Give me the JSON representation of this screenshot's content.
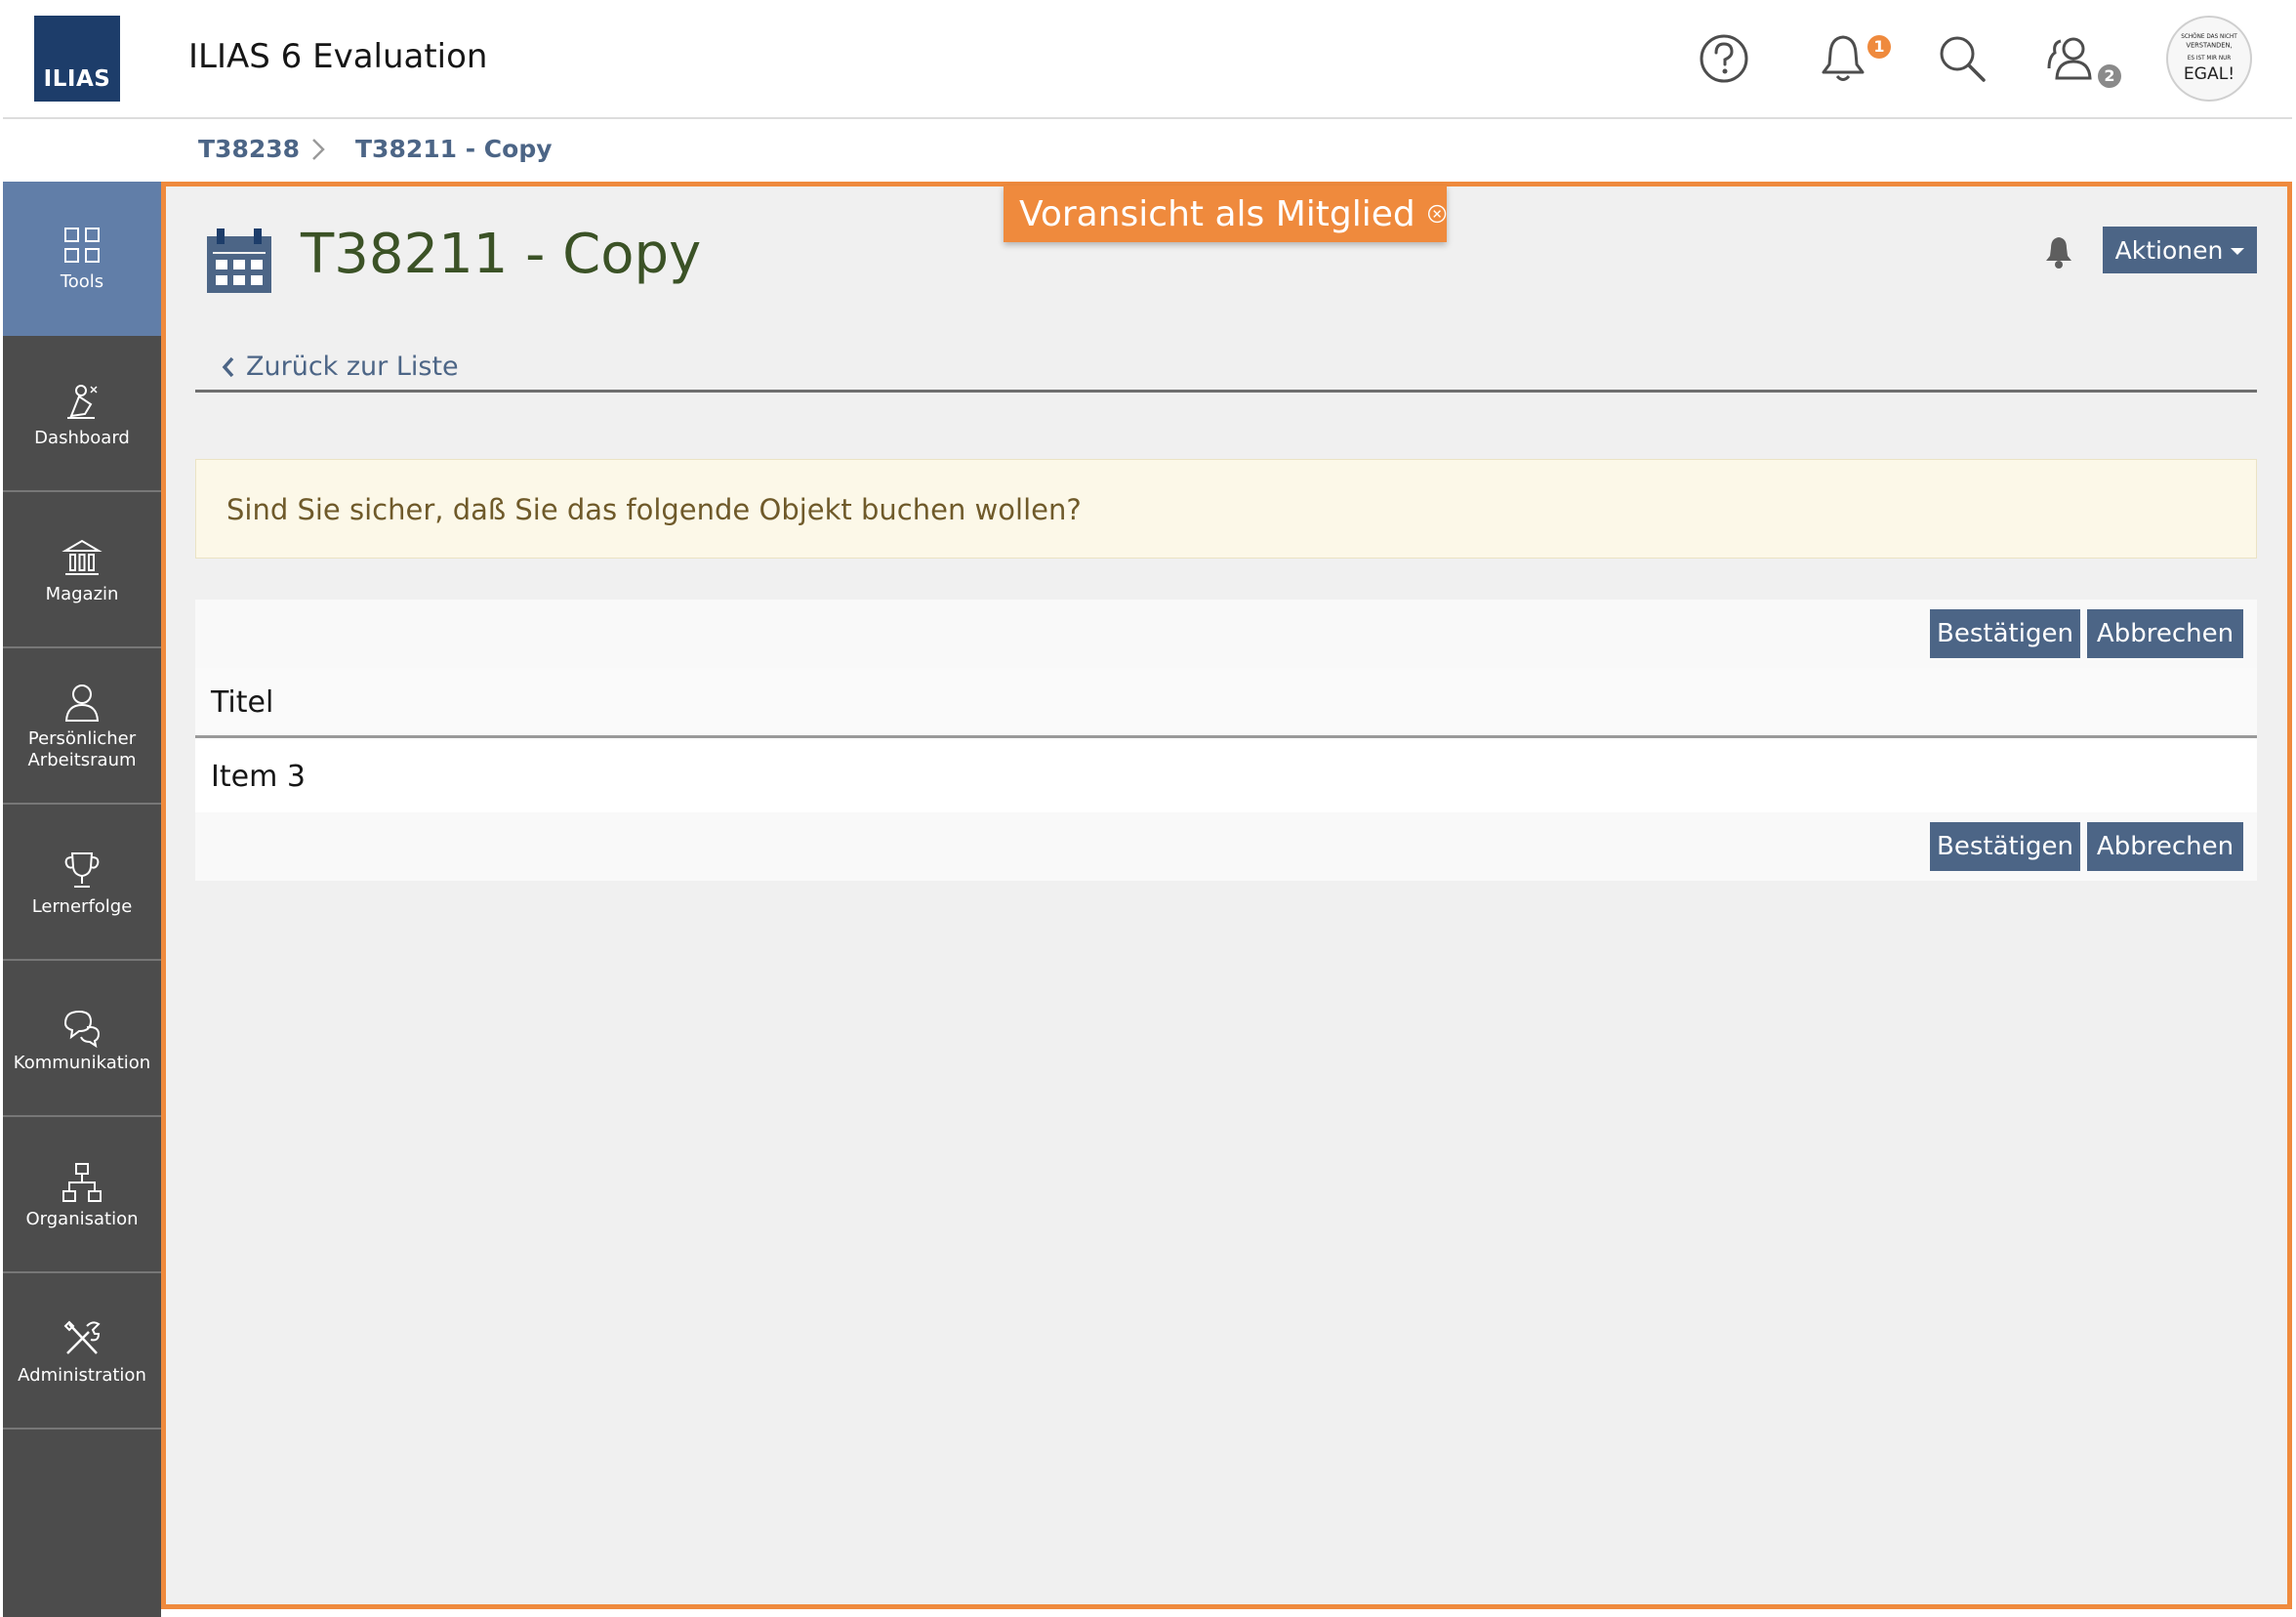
{
  "header": {
    "logo_text": "ILIAS",
    "title": "ILIAS 6 Evaluation",
    "icons": [
      "help-icon",
      "bell-icon",
      "search-icon",
      "contacts-icon"
    ],
    "notification_count": "1",
    "contacts_count": "2",
    "avatar_text": [
      "SCHÖNE DAS NICHT",
      "VERSTANDEN,",
      "ES IST MIR NUR",
      "EGAL!"
    ]
  },
  "breadcrumb": {
    "items": [
      "T38238",
      "T38211 - Copy"
    ]
  },
  "sidebar": {
    "items": [
      {
        "label": "Tools",
        "icon": "tools-icon",
        "active": true
      },
      {
        "label": "Dashboard",
        "icon": "dashboard-icon"
      },
      {
        "label": "Magazin",
        "icon": "repository-icon"
      },
      {
        "label": "Persönlicher Arbeitsraum",
        "label_line1": "Persönlicher",
        "label_line2": "Arbeitsraum",
        "icon": "workspace-icon"
      },
      {
        "label": "Lernerfolge",
        "icon": "trophy-icon"
      },
      {
        "label": "Kommunikation",
        "icon": "chat-icon"
      },
      {
        "label": "Organisation",
        "icon": "org-chart-icon"
      },
      {
        "label": "Administration",
        "icon": "administration-icon"
      }
    ]
  },
  "preview": {
    "label": "Voransicht als Mitglied"
  },
  "page": {
    "title": "T38211 - Copy",
    "actions_label": "Aktionen",
    "back_label": "Zurück zur Liste"
  },
  "message": {
    "text": "Sind Sie sicher, daß Sie das folgende Objekt buchen wollen?"
  },
  "table": {
    "confirm_label": "Bestätigen",
    "cancel_label": "Abbrechen",
    "column_header": "Titel",
    "rows": [
      "Item 3"
    ]
  },
  "colors": {
    "brand": "#1d3d6a",
    "accent": "#4c6586",
    "preview": "#ef8a3d",
    "sidebar": "#4c4c4c",
    "sidebar_active": "#617ea8",
    "title": "#3b5226"
  }
}
